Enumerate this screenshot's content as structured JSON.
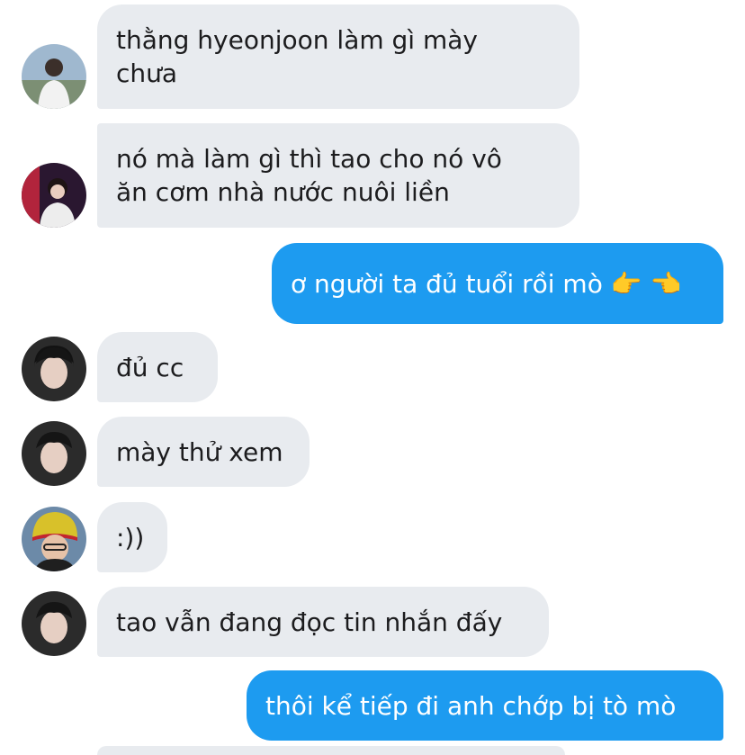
{
  "messages": [
    {
      "sender": "friend-1",
      "direction": "incoming",
      "text": "thằng hyeonjoon làm gì mày chưa"
    },
    {
      "sender": "friend-2",
      "direction": "incoming",
      "text": "nó mà làm gì thì tao cho nó vô ăn cơm nhà nước nuôi liền"
    },
    {
      "sender": "me",
      "direction": "outgoing",
      "text": "ơ người ta đủ tuổi rồi mò 👉 👈"
    },
    {
      "sender": "friend-3",
      "direction": "incoming",
      "text": "đủ cc"
    },
    {
      "sender": "friend-3",
      "direction": "incoming",
      "text": "mày thử xem"
    },
    {
      "sender": "friend-4",
      "direction": "incoming",
      "text": ":))"
    },
    {
      "sender": "friend-3",
      "direction": "incoming",
      "text": "tao vẫn đang đọc tin nhắn đấy"
    },
    {
      "sender": "me",
      "direction": "outgoing",
      "text": "thôi kể tiếp đi anh chớp bị tò mò"
    }
  ],
  "colors": {
    "incoming_bubble": "#e8ebef",
    "outgoing_bubble": "#1d9bf0",
    "incoming_text": "#1c1c1e",
    "outgoing_text": "#ffffff"
  }
}
